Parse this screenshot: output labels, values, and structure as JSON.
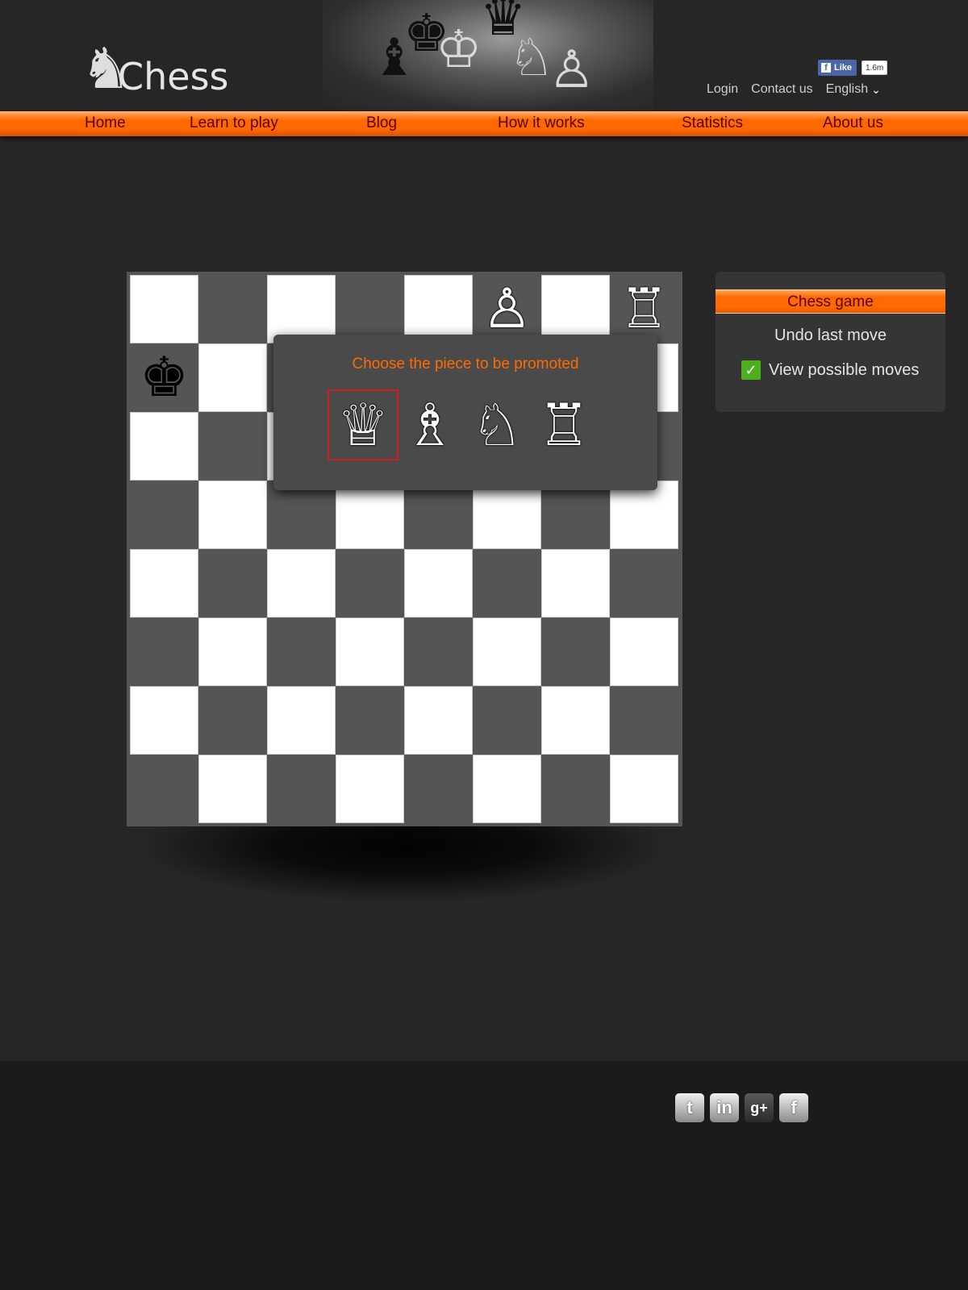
{
  "site": {
    "logo_text": "Chess"
  },
  "facebook": {
    "like_label": "Like",
    "count": "1.6m"
  },
  "toplinks": {
    "login": "Login",
    "contact": "Contact us",
    "language": "English"
  },
  "nav": [
    "Home",
    "Learn to play",
    "Blog",
    "How it works",
    "Statistics",
    "About us"
  ],
  "board": {
    "pieces": [
      {
        "square": "f8",
        "piece": "pawn",
        "color": "white"
      },
      {
        "square": "h8",
        "piece": "rook",
        "color": "white"
      },
      {
        "square": "a7",
        "piece": "king",
        "color": "black"
      }
    ]
  },
  "promotion": {
    "title": "Choose the piece to be promoted",
    "options": [
      "queen",
      "bishop",
      "knight",
      "rook"
    ],
    "selected": "queen"
  },
  "panel": {
    "title": "Chess game",
    "undo": "Undo last move",
    "view_moves": "View possible moves",
    "view_moves_checked": true
  },
  "footer": {
    "social": [
      "twitter-icon",
      "linkedin-icon",
      "google-plus-icon",
      "facebook-icon"
    ]
  },
  "colors": {
    "accent": "#ff6a00",
    "nav_text": "#5a0000",
    "dark_square": "#555555",
    "light_square": "#ffffff"
  }
}
